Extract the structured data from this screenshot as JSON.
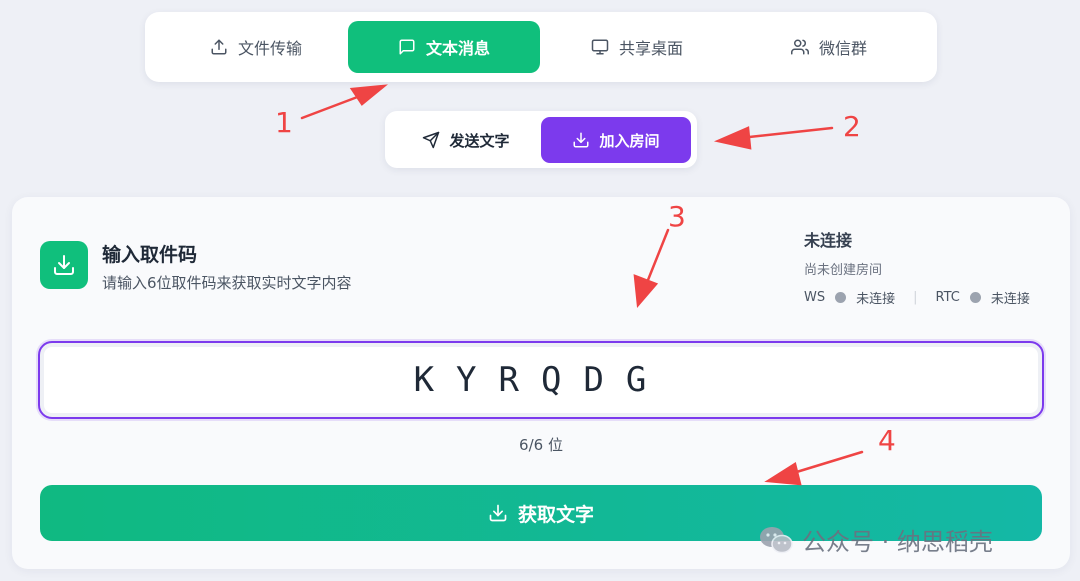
{
  "tabs": [
    {
      "label": "文件传输",
      "icon": "upload-icon"
    },
    {
      "label": "文本消息",
      "icon": "chat-icon",
      "active": true
    },
    {
      "label": "共享桌面",
      "icon": "monitor-icon"
    },
    {
      "label": "微信群",
      "icon": "users-icon"
    }
  ],
  "modes": [
    {
      "label": "发送文字",
      "icon": "send-icon"
    },
    {
      "label": "加入房间",
      "icon": "download-icon",
      "active": true
    }
  ],
  "card": {
    "title": "输入取件码",
    "subtitle": "请输入6位取件码来获取实时文字内容",
    "icon": "download-icon"
  },
  "status": {
    "title": "未连接",
    "subtitle": "尚未创建房间",
    "ws_label": "WS",
    "ws_state": "未连接",
    "separator": "|",
    "rtc_label": "RTC",
    "rtc_state": "未连接"
  },
  "code_input": {
    "value": "KYRQDG"
  },
  "counter": "6/6 位",
  "submit_label": "获取文字",
  "annotations": [
    "1",
    "2",
    "3",
    "4"
  ],
  "watermark": "公众号 · 纳思稻壳",
  "colors": {
    "green": "#10bf7c",
    "purple": "#7c3aed",
    "annotation_red": "#ef4444"
  }
}
